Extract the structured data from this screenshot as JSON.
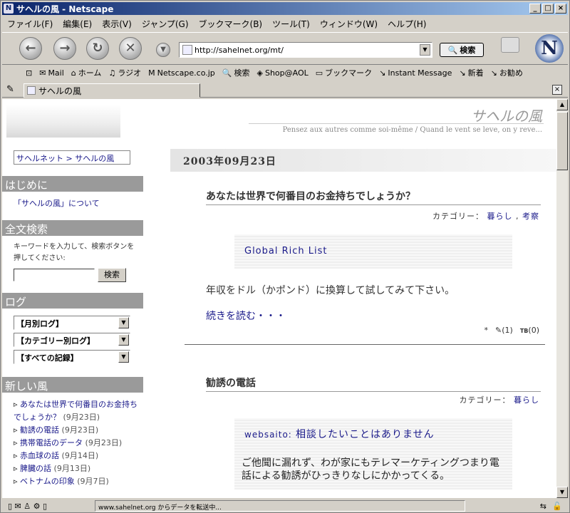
{
  "window": {
    "title": "サヘルの風 - Netscape"
  },
  "menu": [
    "ファイル(F)",
    "編集(E)",
    "表示(V)",
    "ジャンプ(G)",
    "ブックマーク(B)",
    "ツール(T)",
    "ウィンドウ(W)",
    "ヘルプ(H)"
  ],
  "nav": {
    "url": "http://sahelnet.org/mt/",
    "search_label": "検索"
  },
  "bookmarks": [
    "Mail",
    "ホーム",
    "ラジオ",
    "Netscape.co.jp",
    "検索",
    "Shop@AOL",
    "ブックマーク",
    "Instant Message",
    "新着",
    "お勧め"
  ],
  "tab": {
    "label": "サヘルの風"
  },
  "status": {
    "text": "www.sahelnet.org からデータを転送中..."
  },
  "site": {
    "title": "サヘルの風",
    "subtitle": "Pensez aux autres comme soi-même / Quand le vent se leve, on y reve..."
  },
  "sidebar": {
    "breadcrumb": "サヘルネット > サヘルの風",
    "intro_heading": "はじめに",
    "intro_link": "「サヘルの風」について",
    "search_heading": "全文検索",
    "search_help": "キーワードを入力して、検索ボタンを押してください:",
    "search_button": "検索",
    "log_heading": "ログ",
    "selects": [
      "【月別ログ】",
      "【カテゴリー別ログ】",
      "【すべての記録】"
    ],
    "new_heading": "新しい風",
    "new_items": [
      {
        "title": "あなたは世界で何番目のお金持ちでしょうか？",
        "date": "(9月23日)"
      },
      {
        "title": "勧誘の電話",
        "date": "(9月23日)"
      },
      {
        "title": "携帯電話のデータ",
        "date": "(9月23日)"
      },
      {
        "title": "赤血球の話",
        "date": "(9月14日)"
      },
      {
        "title": "脾臓の話",
        "date": "(9月13日)"
      },
      {
        "title": "ベトナムの印象",
        "date": "(9月7日)"
      }
    ]
  },
  "main": {
    "date": "2003年09月23日",
    "entry1": {
      "title": "あなたは世界で何番目のお金持ちでしょうか？",
      "cat_label": "カテゴリー：",
      "cat1": "暮らし",
      "cat_sep": ",",
      "cat2": "考察",
      "quote": "Global Rich List",
      "body": "年収をドル（かポンド）に換算して試してみて下さい。",
      "more": "続きを読む・・・",
      "meta_star": "*",
      "comments": "(1)",
      "tb": "(0)"
    },
    "entry2": {
      "title": "勧誘の電話",
      "cat_label": "カテゴリー：",
      "cat1": "暮らし",
      "quote_author": "websaito:",
      "quote_title": "相談したいことはありません",
      "body": "ご他聞に漏れず、わが家にもテレマーケティングつまり電話による勧誘がひっきりなしにかかってくる。"
    }
  }
}
